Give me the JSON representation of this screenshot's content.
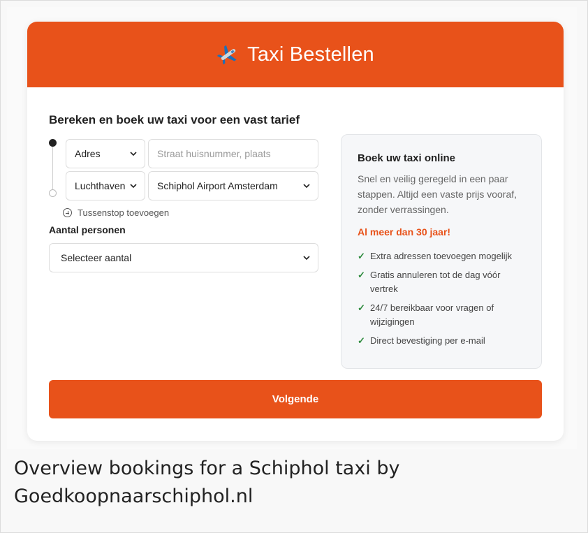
{
  "header": {
    "icon": "airplane-icon",
    "title": "Taxi Bestellen",
    "brand_color": "#e8521a"
  },
  "form": {
    "section_title": "Bereken en boek uw taxi voor een vast tarief",
    "pickup": {
      "type_value": "Adres",
      "address_placeholder": "Straat huisnummer, plaats"
    },
    "dropoff": {
      "type_value": "Luchthaven",
      "location_value": "Schiphol Airport Amsterdam"
    },
    "add_stopover_label": "Tussenstop toevoegen",
    "persons_label": "Aantal personen",
    "persons_value": "Selecteer aantal"
  },
  "info": {
    "title": "Boek uw taxi online",
    "text": "Snel en veilig geregeld in een paar stappen. Altijd een vaste prijs vooraf, zonder verrassingen.",
    "highlight": "Al meer dan 30 jaar!",
    "items": [
      "Extra adressen toevoegen mogelijk",
      "Gratis annuleren tot de dag vóór vertrek",
      "24/7 bereikbaar voor vragen of wijzigingen",
      "Direct bevestiging per e-mail"
    ],
    "check_symbol": "✓",
    "check_color": "#2e8b3e"
  },
  "next_button_label": "Volgende",
  "caption": "Overview bookings for a Schiphol taxi by Goedkoopnaarschiphol.nl"
}
